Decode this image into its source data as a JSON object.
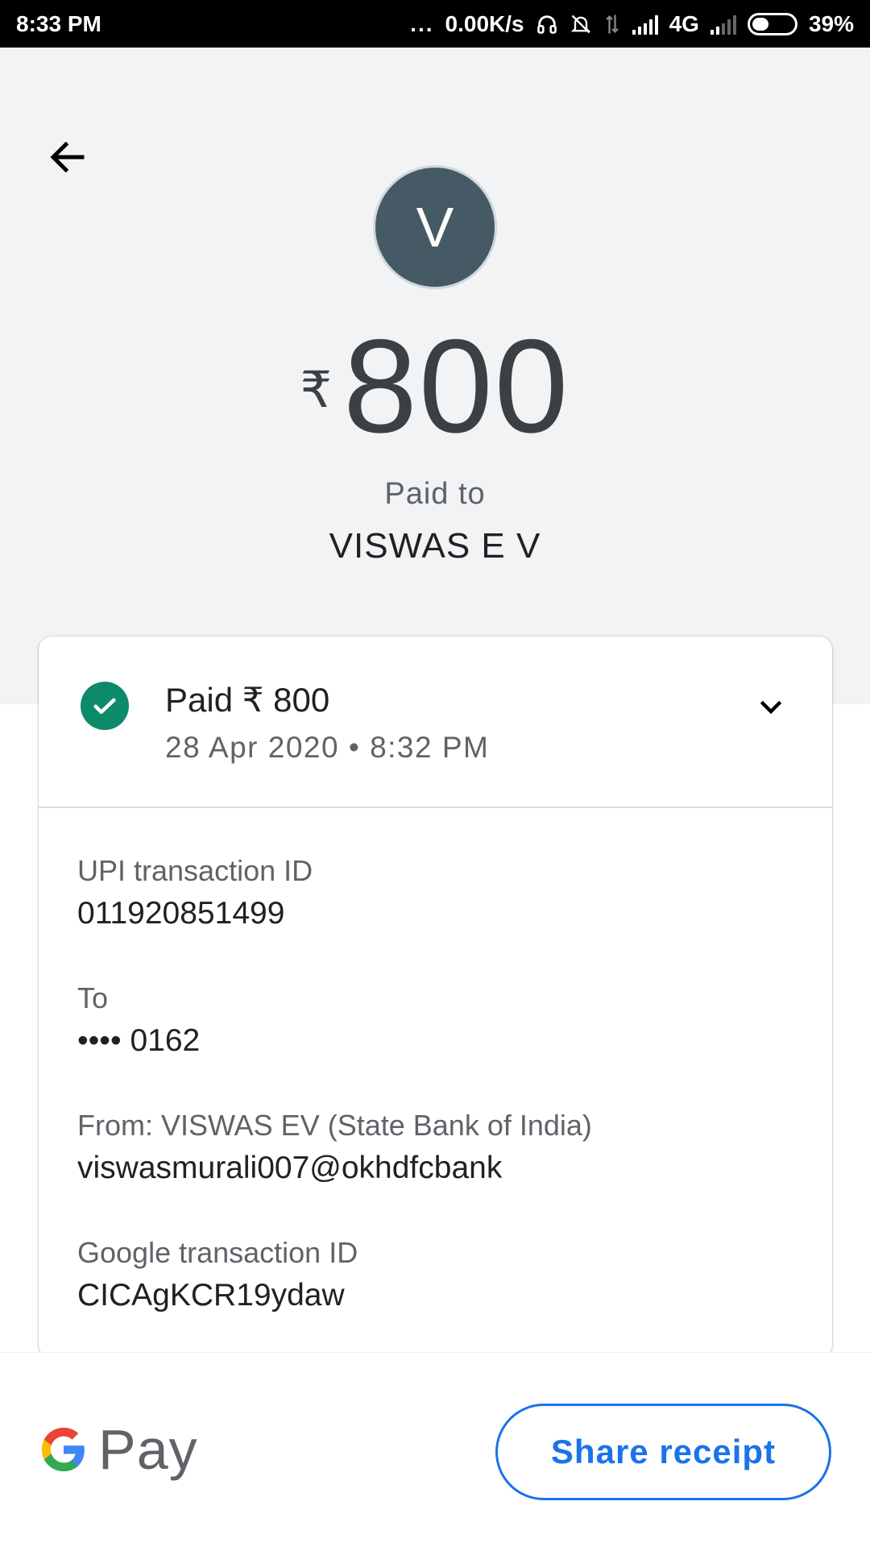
{
  "status_bar": {
    "time": "8:33 PM",
    "more": "...",
    "network_speed": "0.00K/s",
    "network_type": "4G",
    "battery": "39%",
    "battery_level": 0.39
  },
  "header": {
    "avatar_letter": "V",
    "currency_symbol": "₹",
    "amount": "800",
    "paid_to_label": "Paid to",
    "payee_name": "VISWAS E V"
  },
  "card": {
    "status_text": "Paid ₹ 800",
    "datetime": "28 Apr 2020 • 8:32 PM",
    "details": [
      {
        "label": "UPI transaction ID",
        "value": "011920851499"
      },
      {
        "label": "To",
        "value": "•••• 0162"
      },
      {
        "label": "From: VISWAS  EV (State Bank of India)",
        "value": "viswasmurali007@okhdfcbank"
      },
      {
        "label": "Google transaction ID",
        "value": "CICAgKCR19ydaw"
      }
    ]
  },
  "footer": {
    "brand_text": "Pay",
    "share_label": "Share receipt"
  },
  "colors": {
    "accent": "#1a73e8",
    "success": "#0d8a6a",
    "avatar_bg": "#455a64",
    "header_bg": "#f1f3f4"
  }
}
